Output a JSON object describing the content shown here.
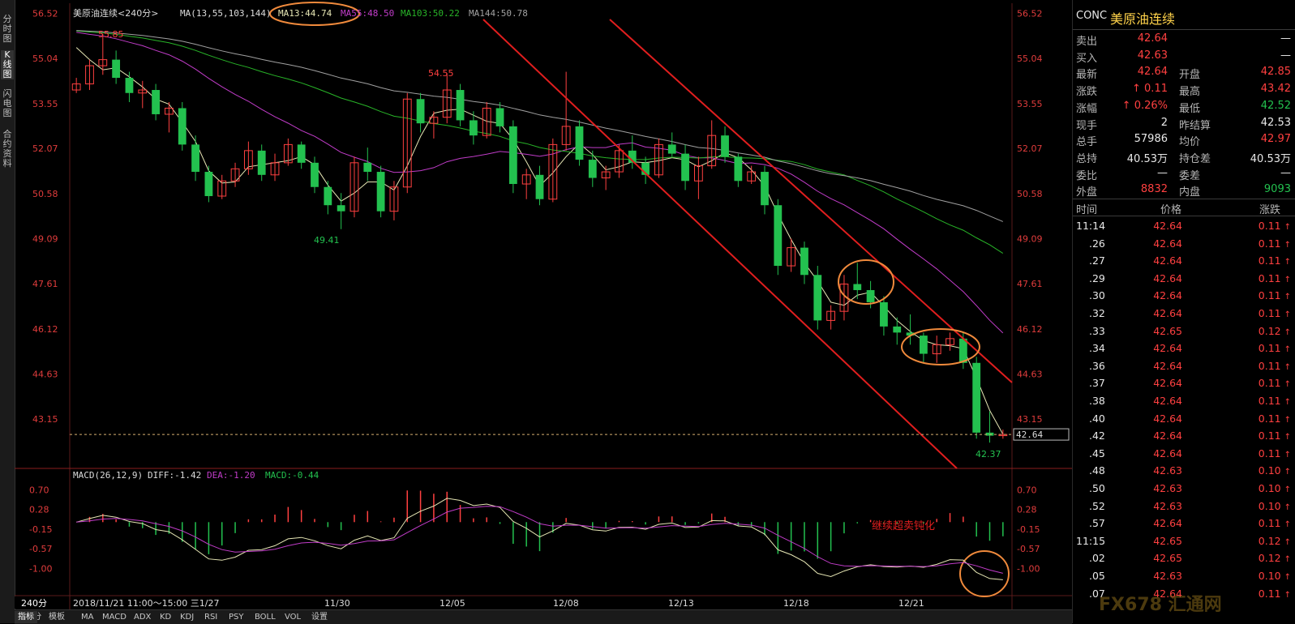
{
  "chart_data": {
    "type": "candlestick",
    "title": "美原油连续",
    "period": "240分",
    "x_tick_labels": [
      "2018/11/21",
      "11/30",
      "12/05",
      "12/08",
      "12/13",
      "12/18",
      "12/21"
    ],
    "cursor_label": "2018/11/21  11:00～15:00 三1/27",
    "price_axis": [
      56.52,
      55.04,
      53.55,
      52.07,
      50.58,
      49.09,
      47.61,
      46.12,
      44.63,
      43.15
    ],
    "ylim": [
      41.6,
      56.7
    ],
    "last_price": "42.64",
    "marks": {
      "high": "55.85",
      "high_mid": "54.55",
      "low_mid": "49.41",
      "low_end": "42.37"
    },
    "ma_legend": {
      "name": "MA(13,55,103,144)",
      "ma13": "MA13:44.74",
      "ma55": "MA55:48.50",
      "ma103": "MA103:50.22",
      "ma144": "MA144:50.78"
    },
    "ma_colors": {
      "ma13": "#e6e6b4",
      "ma55": "#c03cc8",
      "ma103": "#28b428",
      "ma144": "#a0a0a0"
    },
    "candles": [
      [
        54.0,
        54.4,
        53.9,
        54.2
      ],
      [
        54.2,
        55.0,
        54.0,
        54.8
      ],
      [
        54.8,
        55.85,
        54.5,
        55.0
      ],
      [
        55.0,
        55.3,
        54.2,
        54.4
      ],
      [
        54.4,
        54.6,
        53.6,
        53.9
      ],
      [
        53.9,
        54.3,
        53.4,
        54.0
      ],
      [
        54.0,
        54.2,
        53.0,
        53.2
      ],
      [
        53.2,
        53.6,
        52.6,
        53.4
      ],
      [
        53.4,
        53.6,
        52.0,
        52.2
      ],
      [
        52.2,
        52.5,
        51.0,
        51.3
      ],
      [
        51.3,
        51.5,
        50.3,
        50.5
      ],
      [
        50.5,
        51.2,
        50.4,
        51.0
      ],
      [
        51.0,
        51.6,
        50.8,
        51.4
      ],
      [
        51.4,
        52.3,
        51.2,
        52.0
      ],
      [
        52.0,
        52.2,
        51.0,
        51.2
      ],
      [
        51.2,
        51.9,
        51.0,
        51.6
      ],
      [
        51.6,
        52.4,
        51.5,
        52.2
      ],
      [
        52.2,
        52.3,
        51.4,
        51.6
      ],
      [
        51.6,
        51.8,
        50.6,
        50.8
      ],
      [
        50.8,
        51.0,
        49.9,
        50.2
      ],
      [
        50.2,
        50.6,
        49.41,
        50.0
      ],
      [
        50.0,
        51.8,
        49.8,
        51.6
      ],
      [
        51.6,
        52.1,
        51.0,
        51.3
      ],
      [
        51.3,
        51.5,
        49.8,
        50.0
      ],
      [
        50.0,
        51.0,
        49.7,
        50.8
      ],
      [
        50.8,
        53.9,
        50.6,
        53.7
      ],
      [
        53.7,
        53.9,
        52.6,
        52.9
      ],
      [
        52.9,
        53.3,
        52.4,
        53.1
      ],
      [
        53.1,
        54.55,
        52.9,
        54.0
      ],
      [
        54.0,
        54.2,
        52.8,
        53.0
      ],
      [
        53.0,
        53.3,
        52.2,
        52.5
      ],
      [
        52.5,
        53.6,
        52.4,
        53.4
      ],
      [
        53.4,
        53.6,
        52.6,
        52.8
      ],
      [
        52.8,
        53.0,
        50.6,
        50.9
      ],
      [
        50.9,
        51.4,
        50.4,
        51.2
      ],
      [
        51.2,
        51.5,
        50.2,
        50.4
      ],
      [
        50.4,
        52.4,
        50.3,
        52.2
      ],
      [
        52.2,
        54.6,
        52.0,
        52.8
      ],
      [
        52.8,
        53.0,
        51.5,
        51.7
      ],
      [
        51.7,
        52.0,
        50.8,
        51.1
      ],
      [
        51.1,
        51.5,
        50.7,
        51.3
      ],
      [
        51.3,
        52.2,
        51.1,
        52.0
      ],
      [
        52.0,
        52.5,
        51.4,
        51.6
      ],
      [
        51.6,
        51.8,
        50.9,
        51.2
      ],
      [
        51.2,
        52.4,
        51.1,
        52.2
      ],
      [
        52.2,
        52.6,
        51.8,
        51.9
      ],
      [
        51.9,
        52.2,
        50.7,
        51.0
      ],
      [
        51.0,
        51.8,
        50.4,
        51.5
      ],
      [
        51.5,
        53.0,
        51.4,
        52.5
      ],
      [
        52.5,
        52.8,
        51.6,
        51.8
      ],
      [
        51.8,
        51.9,
        50.8,
        51.0
      ],
      [
        51.0,
        51.5,
        50.9,
        51.3
      ],
      [
        51.3,
        51.5,
        49.9,
        50.2
      ],
      [
        50.2,
        50.4,
        47.9,
        48.2
      ],
      [
        48.2,
        49.1,
        48.0,
        48.8
      ],
      [
        48.8,
        49.0,
        47.6,
        47.9
      ],
      [
        47.9,
        48.2,
        46.1,
        46.4
      ],
      [
        46.4,
        46.9,
        46.1,
        46.7
      ],
      [
        46.7,
        47.9,
        46.4,
        47.6
      ],
      [
        47.6,
        48.3,
        47.1,
        47.4
      ],
      [
        47.4,
        47.7,
        46.8,
        47.0
      ],
      [
        47.0,
        47.2,
        45.9,
        46.2
      ],
      [
        46.2,
        46.5,
        45.6,
        46.0
      ],
      [
        46.0,
        46.6,
        45.6,
        45.9
      ],
      [
        45.9,
        46.0,
        45.0,
        45.3
      ],
      [
        45.3,
        45.9,
        45.0,
        45.6
      ],
      [
        45.6,
        46.0,
        45.4,
        45.8
      ],
      [
        45.8,
        46.0,
        44.8,
        45.0
      ],
      [
        45.0,
        45.2,
        42.5,
        42.7
      ],
      [
        42.7,
        43.4,
        42.37,
        42.6
      ],
      [
        42.6,
        42.8,
        42.5,
        42.64
      ]
    ],
    "macd_legend": {
      "name": "MACD(26,12,9)",
      "diff": "DIFF:-1.42",
      "dea": "DEA:-1.20",
      "macd": "MACD:-0.44"
    },
    "macd_axis": [
      "0.70",
      "0.28",
      "-0.15",
      "-0.57",
      "-1.00"
    ],
    "macd_ylim": [
      -1.5,
      0.95
    ],
    "annotation": "继续超卖钝化"
  },
  "quote": {
    "code": "CONC",
    "name": "美原油连续",
    "rows": [
      {
        "l1": "卖出",
        "v1": "42.64",
        "c1": "up",
        "l2": "",
        "v2": "—",
        "c2": "wh"
      },
      {
        "l1": "买入",
        "v1": "42.63",
        "c1": "up",
        "l2": "",
        "v2": "—",
        "c2": "wh"
      },
      {
        "l1": "最新",
        "v1": "42.64",
        "c1": "up",
        "l2": "开盘",
        "v2": "42.85",
        "c2": "up"
      },
      {
        "l1": "涨跌",
        "v1": "↑ 0.11",
        "c1": "up",
        "l2": "最高",
        "v2": "43.42",
        "c2": "up"
      },
      {
        "l1": "涨幅",
        "v1": "↑ 0.26%",
        "c1": "up",
        "l2": "最低",
        "v2": "42.52",
        "c2": "dn"
      },
      {
        "l1": "现手",
        "v1": "2",
        "c1": "wh",
        "l2": "昨结算",
        "v2": "42.53",
        "c2": "wh"
      },
      {
        "l1": "总手",
        "v1": "57986",
        "c1": "wh",
        "l2": "均价",
        "v2": "42.97",
        "c2": "up"
      },
      {
        "l1": "总持",
        "v1": "40.53万",
        "c1": "wh",
        "l2": "持仓差",
        "v2": "40.53万",
        "c2": "wh"
      },
      {
        "l1": "委比",
        "v1": "—",
        "c1": "wh",
        "l2": "委差",
        "v2": "—",
        "c2": "wh"
      },
      {
        "l1": "外盘",
        "v1": "8832",
        "c1": "up",
        "l2": "内盘",
        "v2": "9093",
        "c2": "dn"
      }
    ],
    "tick_header": {
      "time": "时间",
      "price": "价格",
      "change": "涨跌"
    },
    "ticks": [
      {
        "t": "11:14",
        "p": "42.64",
        "c": "0.11"
      },
      {
        "t": ".26",
        "p": "42.64",
        "c": "0.11"
      },
      {
        "t": ".27",
        "p": "42.64",
        "c": "0.11"
      },
      {
        "t": ".29",
        "p": "42.64",
        "c": "0.11"
      },
      {
        "t": ".30",
        "p": "42.64",
        "c": "0.11"
      },
      {
        "t": ".32",
        "p": "42.64",
        "c": "0.11"
      },
      {
        "t": ".33",
        "p": "42.65",
        "c": "0.12"
      },
      {
        "t": ".34",
        "p": "42.64",
        "c": "0.11"
      },
      {
        "t": ".36",
        "p": "42.64",
        "c": "0.11"
      },
      {
        "t": ".37",
        "p": "42.64",
        "c": "0.11"
      },
      {
        "t": ".38",
        "p": "42.64",
        "c": "0.11"
      },
      {
        "t": ".40",
        "p": "42.64",
        "c": "0.11"
      },
      {
        "t": ".42",
        "p": "42.64",
        "c": "0.11"
      },
      {
        "t": ".45",
        "p": "42.64",
        "c": "0.11"
      },
      {
        "t": ".48",
        "p": "42.63",
        "c": "0.10"
      },
      {
        "t": ".50",
        "p": "42.63",
        "c": "0.10"
      },
      {
        "t": ".52",
        "p": "42.63",
        "c": "0.10"
      },
      {
        "t": ".57",
        "p": "42.64",
        "c": "0.11"
      },
      {
        "t": "11:15",
        "p": "42.65",
        "c": "0.12"
      },
      {
        "t": ".02",
        "p": "42.65",
        "c": "0.12"
      },
      {
        "t": ".05",
        "p": "42.63",
        "c": "0.10"
      },
      {
        "t": ".07",
        "p": "42.64",
        "c": "0.11"
      }
    ]
  },
  "left_tabs": [
    "分时图",
    "K线图",
    "闪电图",
    "合约资料"
  ],
  "bottom_tabs": [
    "240分",
    "指标",
    "模板",
    "MA",
    "MACD",
    "ADX",
    "KD",
    "KDJ",
    "RSI",
    "PSY",
    "BOLL",
    "VOL",
    "设置"
  ],
  "watermark": "FX678 汇通网"
}
